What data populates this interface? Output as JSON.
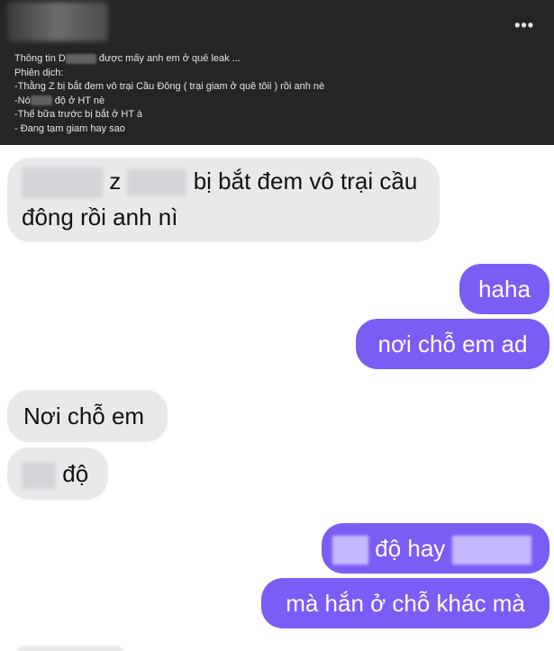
{
  "post": {
    "menu_glyph": "•••",
    "lines": [
      {
        "before": "Thông tin D",
        "after": " được mấy anh em ở quê leak ..."
      },
      {
        "text": "Phiên dịch:"
      },
      {
        "text": "-Thằng Z bị bắt đem vô trại Cầu Đông ( trại giam ở quê tôii ) rồi anh nè"
      },
      {
        "before": "-Nó",
        "after": " độ ở HT nè"
      },
      {
        "text": "-Thế bữa trước bị bắt ở HT à"
      },
      {
        "text": "- Đang tạm giam hay sao"
      }
    ]
  },
  "messages": {
    "m1": {
      "line1_mid": "z",
      "line1_end": "bị bắt đem vô trại cầu",
      "line2": "đông rồi anh nì"
    },
    "m2": {
      "text": "haha"
    },
    "m3": {
      "text": "nơi chỗ em ad"
    },
    "m4": {
      "text": "Nơi chỗ em"
    },
    "m5": {
      "text": "độ"
    },
    "m6": {
      "text": "độ hay"
    },
    "m7": {
      "text": "mà hắn ở chỗ khác mà"
    }
  },
  "colors": {
    "header_bg": "#242526",
    "sent_bubble": "#7b5cf5",
    "received_bubble": "#e9e9eb"
  }
}
